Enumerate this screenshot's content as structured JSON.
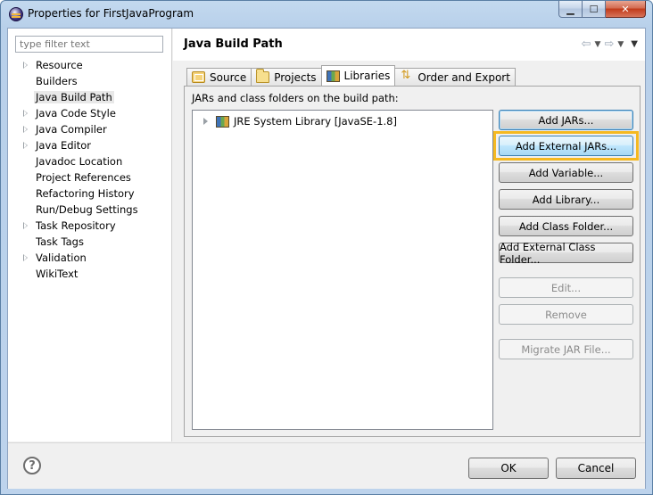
{
  "window": {
    "title": "Properties for FirstJavaProgram"
  },
  "sidebar": {
    "filter_placeholder": "type filter text",
    "items": [
      {
        "label": "Resource",
        "expandable": true
      },
      {
        "label": "Builders",
        "expandable": false
      },
      {
        "label": "Java Build Path",
        "expandable": false,
        "selected": true
      },
      {
        "label": "Java Code Style",
        "expandable": true
      },
      {
        "label": "Java Compiler",
        "expandable": true
      },
      {
        "label": "Java Editor",
        "expandable": true
      },
      {
        "label": "Javadoc Location",
        "expandable": false
      },
      {
        "label": "Project References",
        "expandable": false
      },
      {
        "label": "Refactoring History",
        "expandable": false
      },
      {
        "label": "Run/Debug Settings",
        "expandable": false
      },
      {
        "label": "Task Repository",
        "expandable": true
      },
      {
        "label": "Task Tags",
        "expandable": false
      },
      {
        "label": "Validation",
        "expandable": true
      },
      {
        "label": "WikiText",
        "expandable": false
      }
    ]
  },
  "main": {
    "title": "Java Build Path",
    "tabs": [
      {
        "label": "Source",
        "icon": "source-folder-icon"
      },
      {
        "label": "Projects",
        "icon": "projects-icon"
      },
      {
        "label": "Libraries",
        "icon": "libraries-icon",
        "active": true
      },
      {
        "label": "Order and Export",
        "icon": "order-export-icon"
      }
    ],
    "panel_label": "JARs and class folders on the build path:",
    "libraries": [
      {
        "label": "JRE System Library [JavaSE-1.8]"
      }
    ],
    "buttons": {
      "add_jars": "Add JARs...",
      "add_external_jars": "Add External JARs...",
      "add_variable": "Add Variable...",
      "add_library": "Add Library...",
      "add_class_folder": "Add Class Folder...",
      "add_external_class_folder": "Add External Class Folder...",
      "edit": "Edit...",
      "remove": "Remove",
      "migrate_jar": "Migrate JAR File..."
    }
  },
  "footer": {
    "ok": "OK",
    "cancel": "Cancel"
  },
  "colors": {
    "highlight": "#f5b921",
    "hover_button": "#bee6fd"
  }
}
